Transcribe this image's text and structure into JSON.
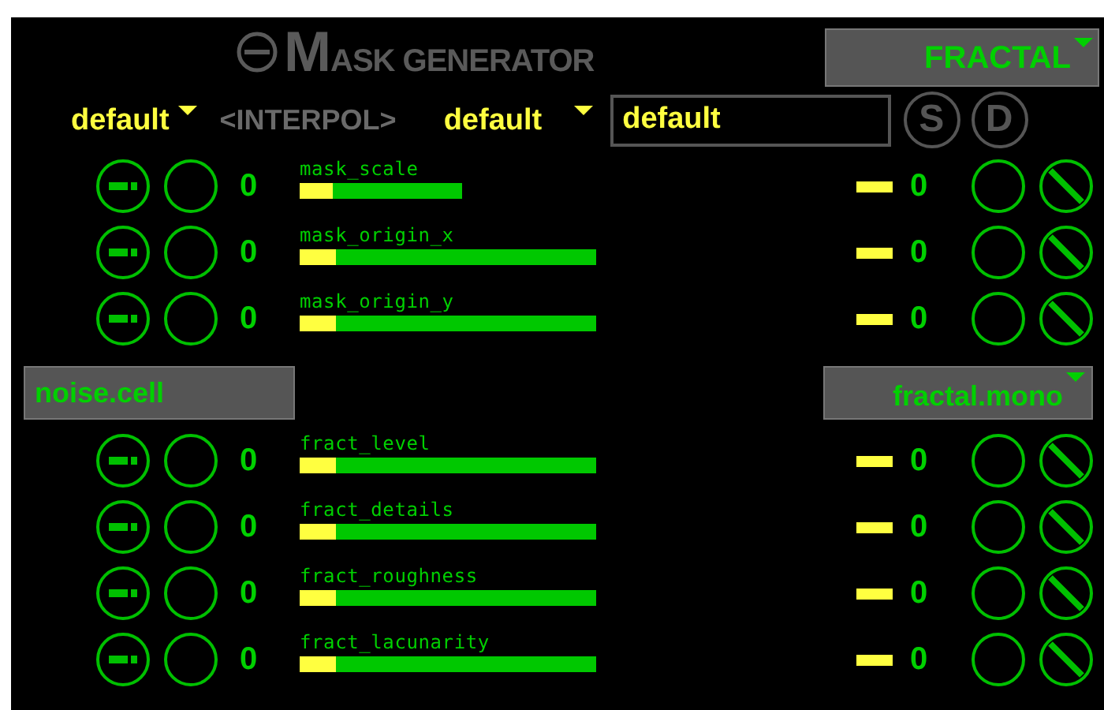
{
  "title": "MASK GENERATOR",
  "mode_dropdown": {
    "value": "FRACTAL"
  },
  "interpolation": {
    "from": "default",
    "label": "<INTERPOL>",
    "to": "default",
    "preset_field": "default",
    "buttons": [
      "S",
      "D"
    ]
  },
  "sections": [
    {
      "params": [
        {
          "name": "mask_scale",
          "left_value": "0",
          "right_value": "0",
          "level": 0.2,
          "kind": "short"
        },
        {
          "name": "mask_origin_x",
          "left_value": "0",
          "right_value": "0",
          "level": 0.12,
          "kind": "long"
        },
        {
          "name": "mask_origin_y",
          "left_value": "0",
          "right_value": "0",
          "level": 0.12,
          "kind": "long"
        }
      ]
    },
    {
      "source": "noise.cell",
      "target": "fractal.mono",
      "params": [
        {
          "name": "fract_level",
          "left_value": "0",
          "right_value": "0",
          "level": 0.12,
          "kind": "long"
        },
        {
          "name": "fract_details",
          "left_value": "0",
          "right_value": "0",
          "level": 0.12,
          "kind": "long"
        },
        {
          "name": "fract_roughness",
          "left_value": "0",
          "right_value": "0",
          "level": 0.12,
          "kind": "long"
        },
        {
          "name": "fract_lacunarity",
          "left_value": "0",
          "right_value": "0",
          "level": 0.12,
          "kind": "long"
        }
      ]
    }
  ]
}
